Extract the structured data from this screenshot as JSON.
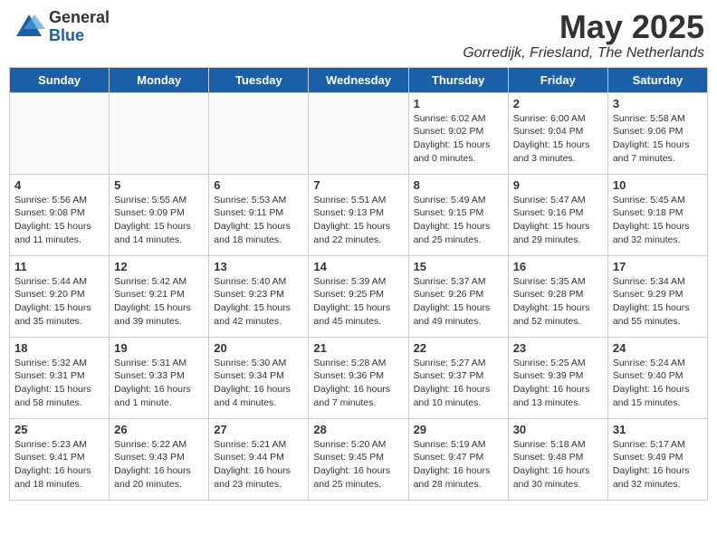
{
  "header": {
    "logo_general": "General",
    "logo_blue": "Blue",
    "month": "May 2025",
    "location": "Gorredijk, Friesland, The Netherlands"
  },
  "days_of_week": [
    "Sunday",
    "Monday",
    "Tuesday",
    "Wednesday",
    "Thursday",
    "Friday",
    "Saturday"
  ],
  "weeks": [
    [
      {
        "day": "",
        "info": ""
      },
      {
        "day": "",
        "info": ""
      },
      {
        "day": "",
        "info": ""
      },
      {
        "day": "",
        "info": ""
      },
      {
        "day": "1",
        "info": "Sunrise: 6:02 AM\nSunset: 9:02 PM\nDaylight: 15 hours\nand 0 minutes."
      },
      {
        "day": "2",
        "info": "Sunrise: 6:00 AM\nSunset: 9:04 PM\nDaylight: 15 hours\nand 3 minutes."
      },
      {
        "day": "3",
        "info": "Sunrise: 5:58 AM\nSunset: 9:06 PM\nDaylight: 15 hours\nand 7 minutes."
      }
    ],
    [
      {
        "day": "4",
        "info": "Sunrise: 5:56 AM\nSunset: 9:08 PM\nDaylight: 15 hours\nand 11 minutes."
      },
      {
        "day": "5",
        "info": "Sunrise: 5:55 AM\nSunset: 9:09 PM\nDaylight: 15 hours\nand 14 minutes."
      },
      {
        "day": "6",
        "info": "Sunrise: 5:53 AM\nSunset: 9:11 PM\nDaylight: 15 hours\nand 18 minutes."
      },
      {
        "day": "7",
        "info": "Sunrise: 5:51 AM\nSunset: 9:13 PM\nDaylight: 15 hours\nand 22 minutes."
      },
      {
        "day": "8",
        "info": "Sunrise: 5:49 AM\nSunset: 9:15 PM\nDaylight: 15 hours\nand 25 minutes."
      },
      {
        "day": "9",
        "info": "Sunrise: 5:47 AM\nSunset: 9:16 PM\nDaylight: 15 hours\nand 29 minutes."
      },
      {
        "day": "10",
        "info": "Sunrise: 5:45 AM\nSunset: 9:18 PM\nDaylight: 15 hours\nand 32 minutes."
      }
    ],
    [
      {
        "day": "11",
        "info": "Sunrise: 5:44 AM\nSunset: 9:20 PM\nDaylight: 15 hours\nand 35 minutes."
      },
      {
        "day": "12",
        "info": "Sunrise: 5:42 AM\nSunset: 9:21 PM\nDaylight: 15 hours\nand 39 minutes."
      },
      {
        "day": "13",
        "info": "Sunrise: 5:40 AM\nSunset: 9:23 PM\nDaylight: 15 hours\nand 42 minutes."
      },
      {
        "day": "14",
        "info": "Sunrise: 5:39 AM\nSunset: 9:25 PM\nDaylight: 15 hours\nand 45 minutes."
      },
      {
        "day": "15",
        "info": "Sunrise: 5:37 AM\nSunset: 9:26 PM\nDaylight: 15 hours\nand 49 minutes."
      },
      {
        "day": "16",
        "info": "Sunrise: 5:35 AM\nSunset: 9:28 PM\nDaylight: 15 hours\nand 52 minutes."
      },
      {
        "day": "17",
        "info": "Sunrise: 5:34 AM\nSunset: 9:29 PM\nDaylight: 15 hours\nand 55 minutes."
      }
    ],
    [
      {
        "day": "18",
        "info": "Sunrise: 5:32 AM\nSunset: 9:31 PM\nDaylight: 15 hours\nand 58 minutes."
      },
      {
        "day": "19",
        "info": "Sunrise: 5:31 AM\nSunset: 9:33 PM\nDaylight: 16 hours\nand 1 minute."
      },
      {
        "day": "20",
        "info": "Sunrise: 5:30 AM\nSunset: 9:34 PM\nDaylight: 16 hours\nand 4 minutes."
      },
      {
        "day": "21",
        "info": "Sunrise: 5:28 AM\nSunset: 9:36 PM\nDaylight: 16 hours\nand 7 minutes."
      },
      {
        "day": "22",
        "info": "Sunrise: 5:27 AM\nSunset: 9:37 PM\nDaylight: 16 hours\nand 10 minutes."
      },
      {
        "day": "23",
        "info": "Sunrise: 5:25 AM\nSunset: 9:39 PM\nDaylight: 16 hours\nand 13 minutes."
      },
      {
        "day": "24",
        "info": "Sunrise: 5:24 AM\nSunset: 9:40 PM\nDaylight: 16 hours\nand 15 minutes."
      }
    ],
    [
      {
        "day": "25",
        "info": "Sunrise: 5:23 AM\nSunset: 9:41 PM\nDaylight: 16 hours\nand 18 minutes."
      },
      {
        "day": "26",
        "info": "Sunrise: 5:22 AM\nSunset: 9:43 PM\nDaylight: 16 hours\nand 20 minutes."
      },
      {
        "day": "27",
        "info": "Sunrise: 5:21 AM\nSunset: 9:44 PM\nDaylight: 16 hours\nand 23 minutes."
      },
      {
        "day": "28",
        "info": "Sunrise: 5:20 AM\nSunset: 9:45 PM\nDaylight: 16 hours\nand 25 minutes."
      },
      {
        "day": "29",
        "info": "Sunrise: 5:19 AM\nSunset: 9:47 PM\nDaylight: 16 hours\nand 28 minutes."
      },
      {
        "day": "30",
        "info": "Sunrise: 5:18 AM\nSunset: 9:48 PM\nDaylight: 16 hours\nand 30 minutes."
      },
      {
        "day": "31",
        "info": "Sunrise: 5:17 AM\nSunset: 9:49 PM\nDaylight: 16 hours\nand 32 minutes."
      }
    ]
  ]
}
